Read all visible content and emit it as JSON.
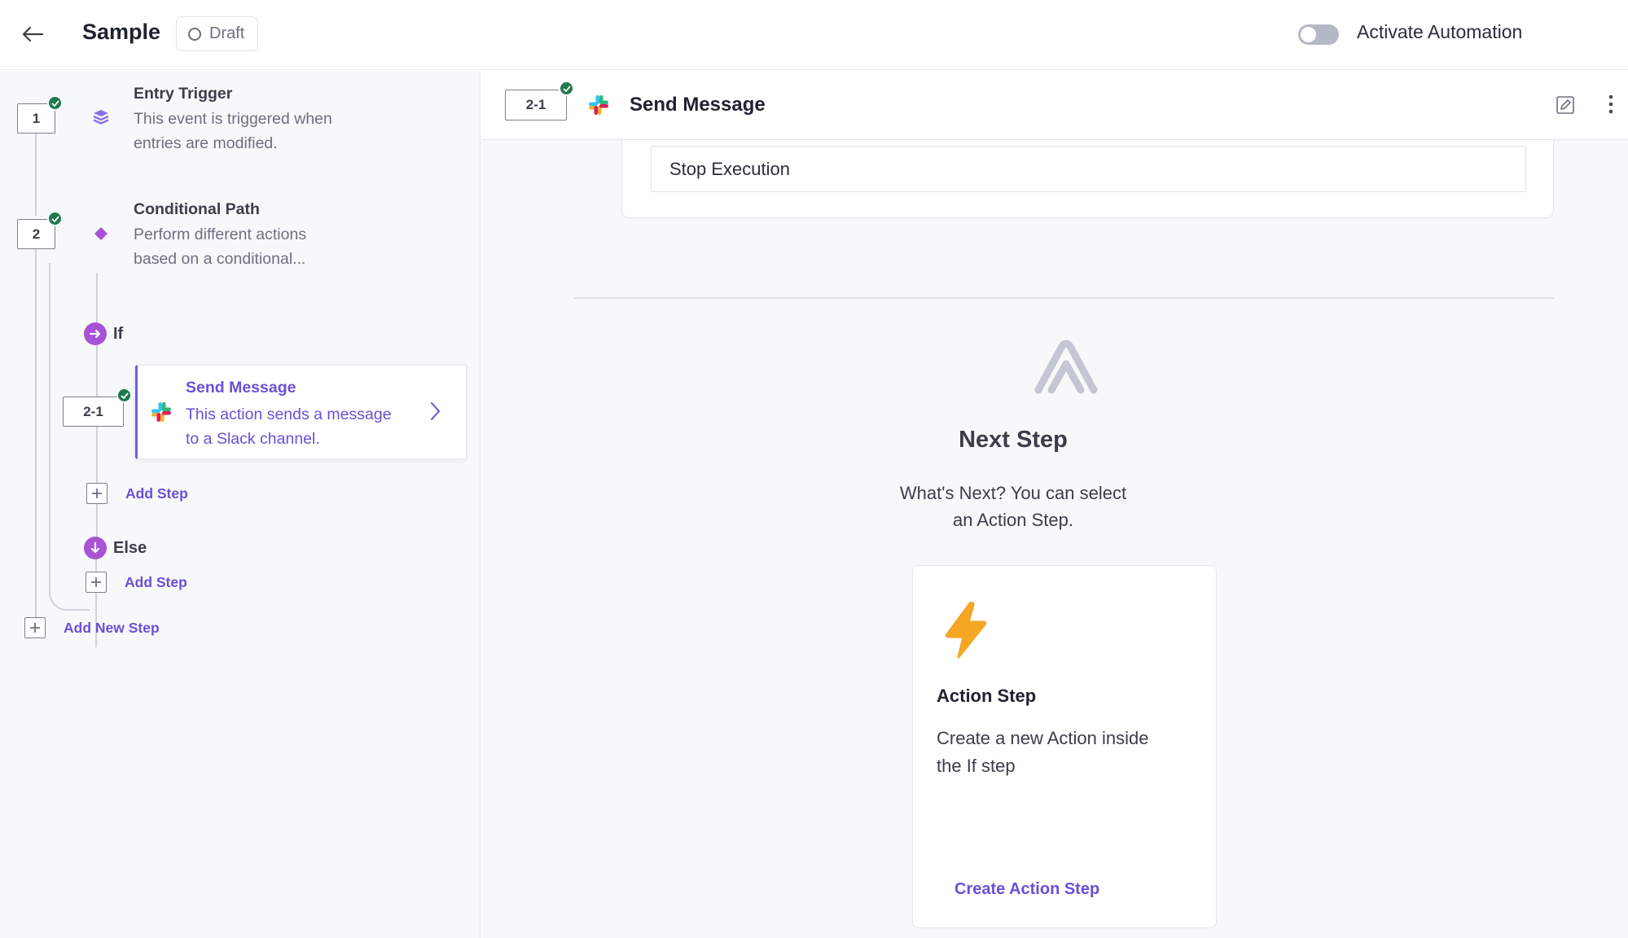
{
  "header": {
    "title": "Sample",
    "status": "Draft",
    "activate_label": "Activate Automation",
    "activate_on": false
  },
  "sidebar": {
    "steps": [
      {
        "number": "1",
        "title": "Entry Trigger",
        "desc_line1": "This event is triggered when",
        "desc_line2": "entries are modified."
      },
      {
        "number": "2",
        "title": "Conditional Path",
        "desc_line1": "Perform different actions",
        "desc_line2": "based on a conditional..."
      }
    ],
    "if_label": "If",
    "else_label": "Else",
    "selected": {
      "number": "2-1",
      "title": "Send Message",
      "desc_line1": "This action sends a message",
      "desc_line2": "to a Slack channel."
    },
    "add_step_label": "Add Step",
    "add_new_step_label": "Add New Step"
  },
  "main": {
    "header": {
      "number": "2-1",
      "title": "Send Message"
    },
    "stop_input_value": "Stop Execution",
    "next": {
      "title": "Next Step",
      "desc_line1": "What's Next? You can select",
      "desc_line2": "an Action Step."
    },
    "action_card": {
      "title": "Action Step",
      "desc_line1": "Create a new Action inside",
      "desc_line2": "the If step",
      "link": "Create Action Step"
    }
  },
  "colors": {
    "accent": "#6c4fd6",
    "check_green": "#1e7a4e",
    "branch_purple": "#a852d6",
    "bolt_orange": "#f5a623"
  },
  "icons": [
    "back-arrow-icon",
    "draft-circle-icon",
    "stack-icon",
    "diamond-icon",
    "arrow-right-icon",
    "arrow-down-icon",
    "slack-icon",
    "chevron-right-icon",
    "plus-icon",
    "edit-icon",
    "more-vertical-icon",
    "brand-logo-icon",
    "lightning-icon",
    "check-icon"
  ]
}
